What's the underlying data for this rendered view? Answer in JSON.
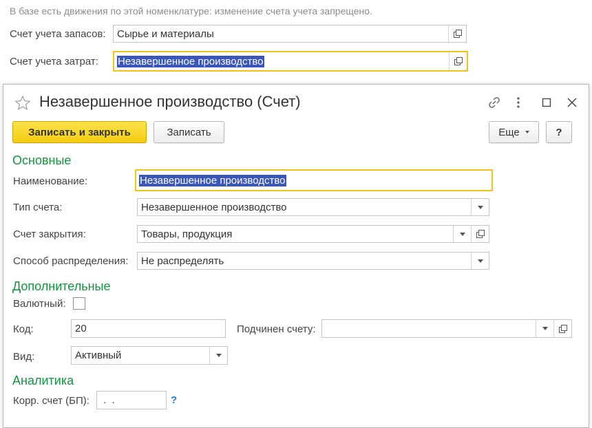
{
  "background_form": {
    "notice": "В базе есть движения по этой номенклатуре: изменение счета учета запрещено.",
    "stock_account_label": "Счет учета запасов:",
    "stock_account_value": "Сырье и материалы",
    "cost_account_label": "Счет учета затрат:",
    "cost_account_value": "Незавершенное производство"
  },
  "dialog": {
    "title": "Незавершенное производство (Счет)",
    "toolbar": {
      "save_close_label": "Записать и закрыть",
      "save_label": "Записать",
      "more_label": "Еще",
      "help_label": "?"
    },
    "main_section": {
      "title": "Основные",
      "name_label": "Наименование:",
      "name_value": "Незавершенное производство",
      "account_type_label": "Тип счета:",
      "account_type_value": "Незавершенное производство",
      "closing_account_label": "Счет закрытия:",
      "closing_account_value": "Товары, продукция",
      "distribution_label": "Способ распределения:",
      "distribution_value": "Не распределять"
    },
    "additional_section": {
      "title": "Дополнительные",
      "currency_label": "Валютный:",
      "currency_checked": false,
      "code_label": "Код:",
      "code_value": "20",
      "parent_label": "Подчинен счету:",
      "parent_value": "",
      "kind_label": "Вид:",
      "kind_value": "Активный"
    },
    "analytics_section": {
      "title": "Аналитика",
      "corr_label": "Корр. счет (БП):",
      "corr_value": " .  .",
      "help_mark": "?"
    }
  },
  "colors": {
    "section_green": "#169242",
    "focus_yellow": "#f0c21c",
    "selection_blue": "#3a56b8",
    "primary_button": "#f4cc12",
    "help_blue": "#2a7bc8"
  }
}
